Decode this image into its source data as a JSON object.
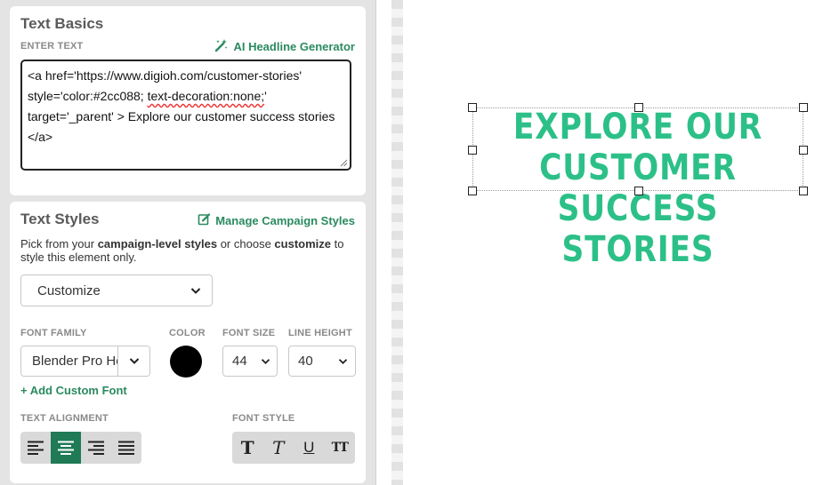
{
  "text_basics": {
    "title": "Text Basics",
    "enter_text_label": "ENTER TEXT",
    "ai_generator_label": "AI Headline Generator",
    "textarea": {
      "part1": "<a href='https://www.digioh.com/customer-stories' style='color:#2cc088; ",
      "squiggle": "text-decoration:none;",
      "part2": "' target='_parent' > Explore our customer success stories </a>"
    }
  },
  "text_styles": {
    "title": "Text Styles",
    "manage_label": "Manage Campaign Styles",
    "help_prefix": "Pick from your ",
    "help_bold1": "campaign-level styles",
    "help_mid": " or choose ",
    "help_bold2": "customize",
    "help_suffix": " to style this element only.",
    "style_select": "Customize",
    "font_family_label": "FONT FAMILY",
    "font_family_value": "Blender Pro Heavy",
    "color_label": "COLOR",
    "color_value": "#000000",
    "font_size_label": "FONT SIZE",
    "font_size_value": "44",
    "line_height_label": "LINE HEIGHT",
    "line_height_value": "40",
    "add_font_label": "+ Add Custom Font",
    "alignment_label": "TEXT ALIGNMENT",
    "alignment_options": [
      "align-left",
      "align-center",
      "align-right",
      "align-justify"
    ],
    "alignment_selected": "align-center",
    "font_style_label": "FONT STYLE",
    "font_style_options": [
      "bold",
      "italic",
      "underline",
      "uppercase"
    ]
  },
  "canvas": {
    "headline": "Explore our customer success stories",
    "headline_color": "#2cc088"
  },
  "colors": {
    "accent": "#2a8a5f",
    "active_button": "#1f7a55",
    "headline": "#2cc088"
  }
}
